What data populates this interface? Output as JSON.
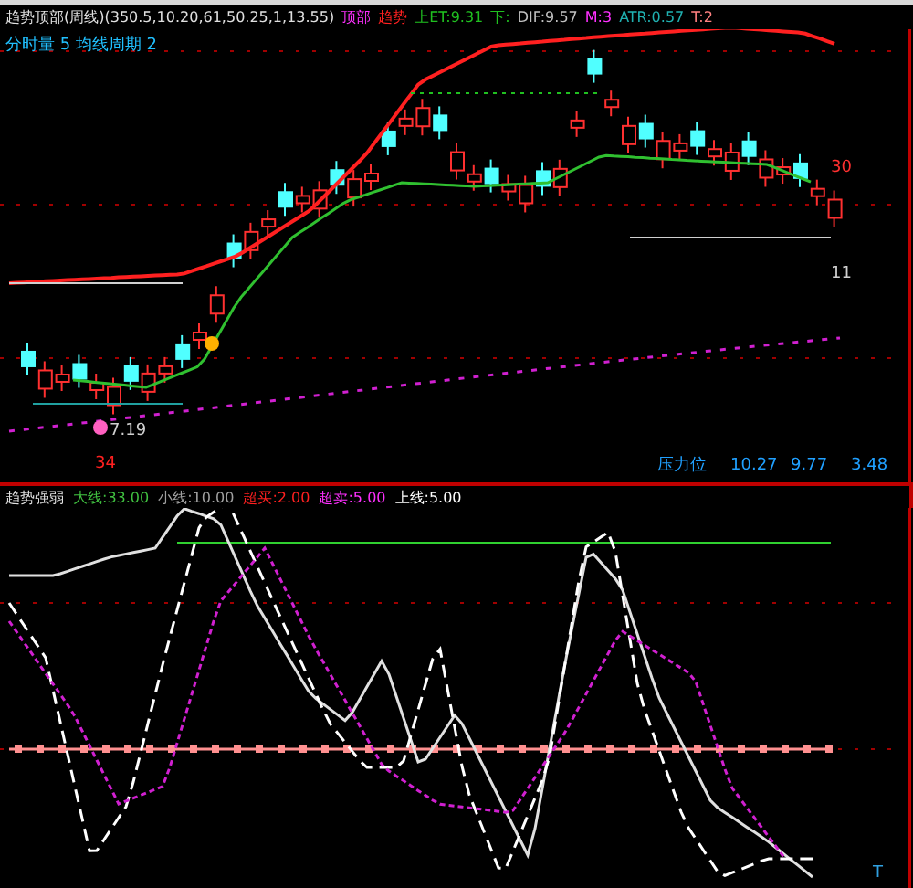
{
  "top_legend": [
    {
      "text": "趋势顶部(周线)(350.5,10.20,61,50.25,1,13.55)",
      "color": "#e0e0e0"
    },
    {
      "text": "顶部",
      "color": "#ff30ff"
    },
    {
      "text": "趋势",
      "color": "#ff2020"
    },
    {
      "text": "上ET:9.31",
      "color": "#20c020"
    },
    {
      "text": "下:",
      "color": "#20c020"
    },
    {
      "text": "DIF:9.57",
      "color": "#c0c0c0"
    },
    {
      "text": "M:3",
      "color": "#ff30ff"
    },
    {
      "text": "ATR:0.57",
      "color": "#20b0b0"
    },
    {
      "text": "T:2",
      "color": "#ff8080"
    }
  ],
  "upper_panel": {
    "title": "分时量 5 均线周期 2",
    "price_labels": [
      {
        "text": "30",
        "kind": "high"
      },
      {
        "text": "11",
        "kind": "right"
      },
      {
        "text": "7.19",
        "kind": "low"
      },
      {
        "text": "34",
        "kind": "bottom"
      }
    ],
    "info": {
      "label": "压力位",
      "values": [
        "10.27",
        "9.77",
        "3.48"
      ]
    }
  },
  "lower_panel": {
    "legend": [
      {
        "text": "趋势强弱",
        "color": "#e0e0e0"
      },
      {
        "text": "大线:33.00",
        "color": "#40c040"
      },
      {
        "text": "小线:10.00",
        "color": "#a0a0a0"
      },
      {
        "text": "超买:2.00",
        "color": "#ff2020"
      },
      {
        "text": "超卖:5.00",
        "color": "#ff30ff"
      },
      {
        "text": "上线:5.00",
        "color": "#ffffff"
      }
    ],
    "marker": "T"
  }
}
